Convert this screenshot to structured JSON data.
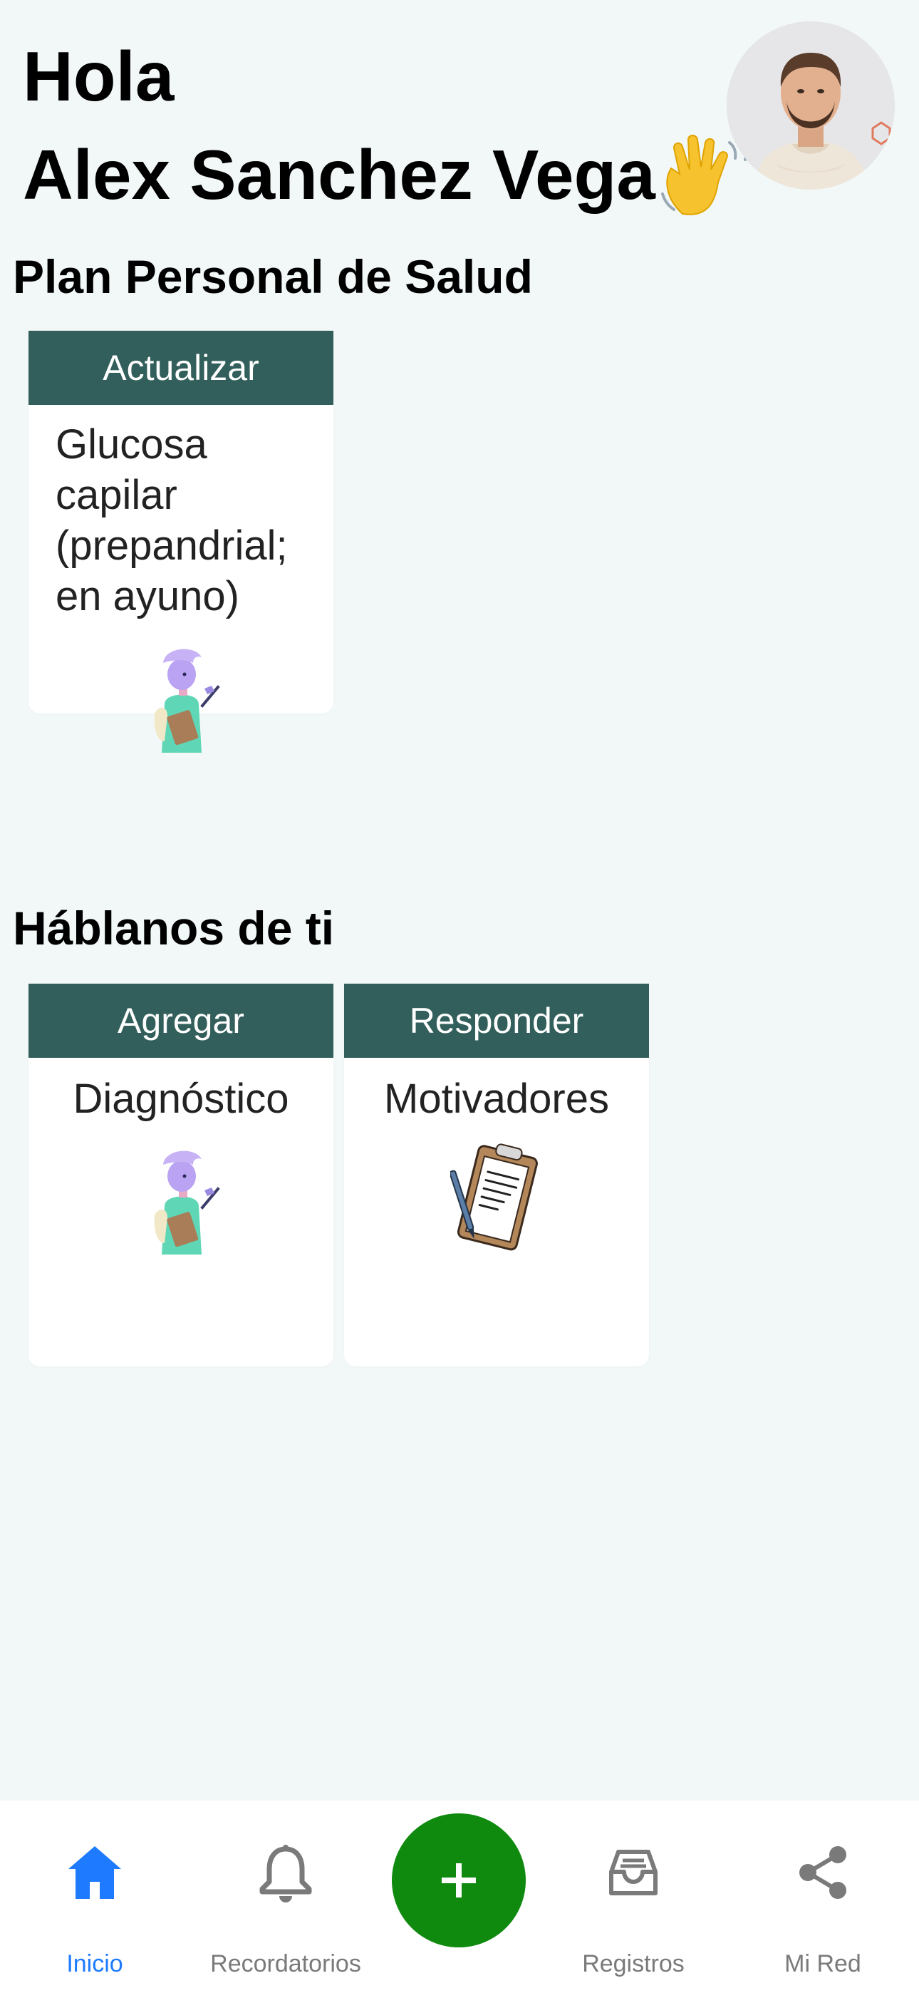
{
  "header": {
    "greeting": "Hola",
    "user_name": "Alex Sanchez Vega"
  },
  "plan": {
    "title": "Plan Personal de Salud",
    "cards": [
      {
        "action": "Actualizar",
        "label": "Glucosa capilar (prepandrial; en ayuno)",
        "illustration": "doctor-with-clipboard"
      }
    ]
  },
  "about": {
    "title": "Háblanos de ti",
    "cards": [
      {
        "action": "Agregar",
        "label": "Diagnóstico",
        "illustration": "doctor-with-clipboard"
      },
      {
        "action": "Responder",
        "label": "Motivadores",
        "illustration": "clipboard-with-pen"
      }
    ]
  },
  "bottom_nav": {
    "items": [
      {
        "label": "Inicio",
        "icon": "home-icon",
        "active": true
      },
      {
        "label": "Recordatorios",
        "icon": "bell-icon",
        "active": false
      },
      {
        "label": "Registros",
        "icon": "inbox-icon",
        "active": false
      },
      {
        "label": "Mi Red",
        "icon": "share-icon",
        "active": false
      }
    ],
    "fab_icon": "plus-icon"
  },
  "colors": {
    "background": "#f2f8f8",
    "card_header": "#325f5b",
    "active_nav": "#1e7bff",
    "fab": "#0f8a0f"
  }
}
